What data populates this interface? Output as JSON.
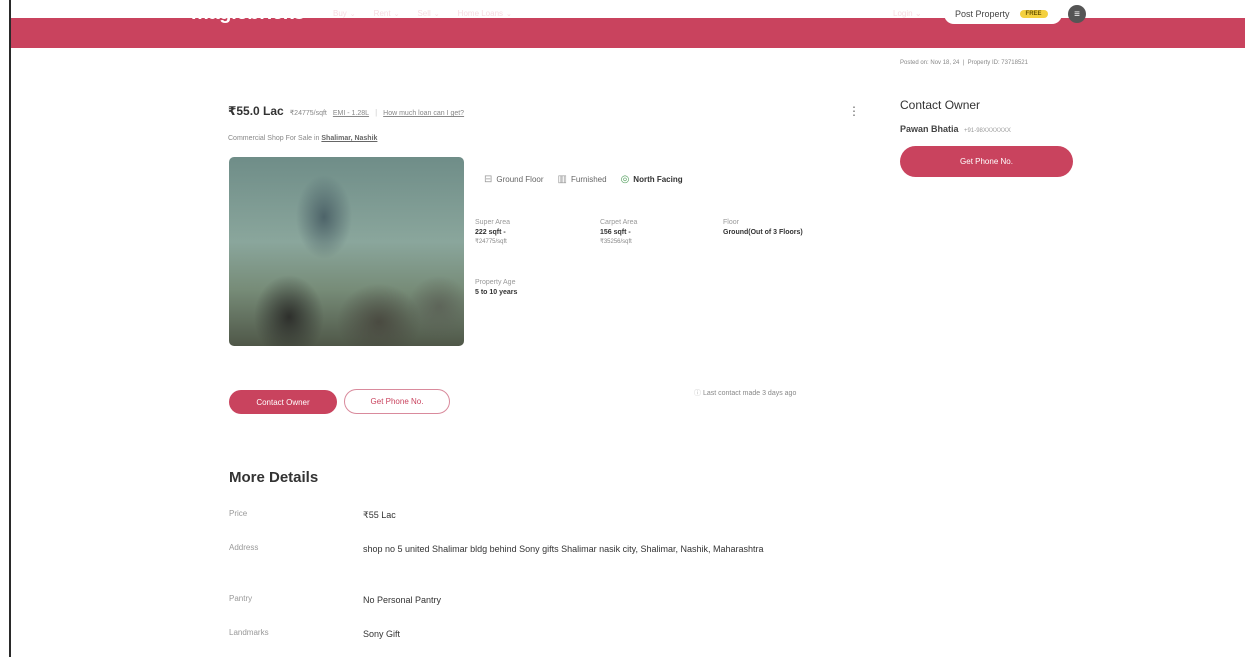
{
  "header": {
    "logo": "magicbricks",
    "nav": [
      {
        "label": "Buy"
      },
      {
        "label": "Rent"
      },
      {
        "label": "Sell"
      },
      {
        "label": "Home Loans"
      }
    ],
    "login": "Login",
    "post_property": "Post Property",
    "post_badge": "FREE",
    "menu_icon": "hamburger-icon",
    "accent": "#c9435e"
  },
  "meta": {
    "posted": "Posted on: Nov 18, 24",
    "property_id": "Property ID: 73718521"
  },
  "listing": {
    "price": "₹55.0 Lac",
    "price_per_sqft": "₹24775/sqft",
    "emi": "EMI - 1.28L",
    "loan_link": "How much loan can I get?",
    "title_prefix": "Commercial Shop For Sale in",
    "location": "Shalimar, Nashik",
    "chips": [
      {
        "icon": "stairs-icon",
        "label": "Ground Floor"
      },
      {
        "icon": "furniture-icon",
        "label": "Furnished"
      },
      {
        "icon": "compass-icon",
        "label": "North Facing"
      }
    ],
    "specs": {
      "super_area_label": "Super Area",
      "super_area_value": "222 sqft -",
      "super_area_sub": "₹24775/sqft",
      "carpet_area_label": "Carpet Area",
      "carpet_area_value": "156 sqft -",
      "carpet_area_sub": "₹35256/sqft",
      "floor_label": "Floor",
      "floor_value": "Ground(Out of 3 Floors)",
      "age_label": "Property Age",
      "age_value": "5 to 10 years"
    },
    "contact_owner": "Contact Owner",
    "get_phone": "Get Phone No.",
    "last_contact": "Last contact made 3 days ago"
  },
  "owner_card": {
    "title": "Contact Owner",
    "name": "Pawan Bhatia",
    "phone_masked": "+91-98XXXXXXX",
    "button": "Get Phone No."
  },
  "more_details": {
    "title": "More Details",
    "rows": [
      {
        "key": "Price",
        "value": "₹55 Lac"
      },
      {
        "key": "Address",
        "value": "shop no 5 united Shalimar bldg behind Sony gifts Shalimar nasik city, Shalimar, Nashik, Maharashtra"
      },
      {
        "key": "Pantry",
        "value": "No Personal Pantry"
      },
      {
        "key": "Landmarks",
        "value": "Sony Gift"
      }
    ]
  }
}
